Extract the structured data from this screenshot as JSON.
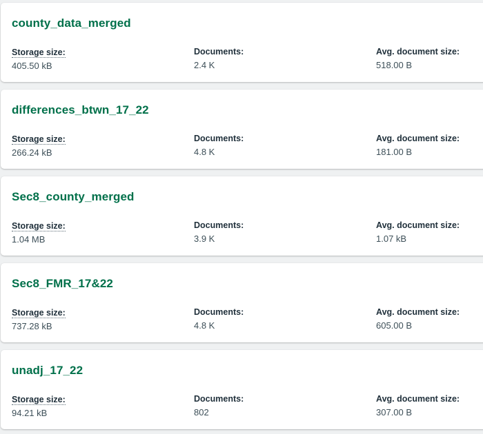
{
  "collections": [
    {
      "name": "county_data_merged",
      "storage_label": "Storage size:",
      "storage_value": "405.50 kB",
      "documents_label": "Documents:",
      "documents_value": "2.4 K",
      "avg_label": "Avg. document size:",
      "avg_value": "518.00 B"
    },
    {
      "name": "differences_btwn_17_22",
      "storage_label": "Storage size:",
      "storage_value": "266.24 kB",
      "documents_label": "Documents:",
      "documents_value": "4.8 K",
      "avg_label": "Avg. document size:",
      "avg_value": "181.00 B"
    },
    {
      "name": "Sec8_county_merged",
      "storage_label": "Storage size:",
      "storage_value": "1.04 MB",
      "documents_label": "Documents:",
      "documents_value": "3.9 K",
      "avg_label": "Avg. document size:",
      "avg_value": "1.07 kB"
    },
    {
      "name": "Sec8_FMR_17&22",
      "storage_label": "Storage size:",
      "storage_value": "737.28 kB",
      "documents_label": "Documents:",
      "documents_value": "4.8 K",
      "avg_label": "Avg. document size:",
      "avg_value": "605.00 B"
    },
    {
      "name": "unadj_17_22",
      "storage_label": "Storage size:",
      "storage_value": "94.21 kB",
      "documents_label": "Documents:",
      "documents_value": "802",
      "avg_label": "Avg. document size:",
      "avg_value": "307.00 B"
    }
  ],
  "colors": {
    "title_green": "#00704a",
    "label_dark": "#21313c",
    "value_gray": "#3d4f58",
    "background": "#eff1f2"
  }
}
